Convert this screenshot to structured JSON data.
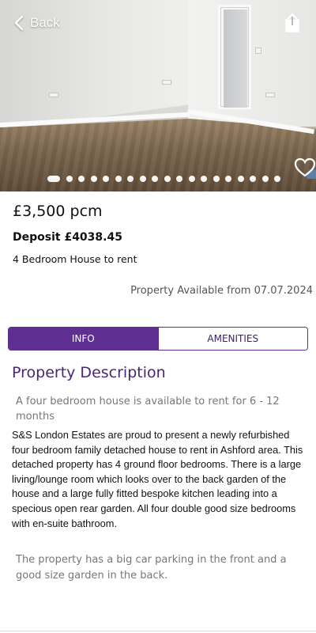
{
  "header": {
    "back_label": "Back",
    "back_icon": "chevron-left-icon",
    "share_icon": "share-icon",
    "favorite_icon": "heart-icon"
  },
  "gallery": {
    "image_count": 19,
    "active_index": 0
  },
  "listing": {
    "price": "£3,500 pcm",
    "deposit": "Deposit £4038.45",
    "type": "4 Bedroom House to rent",
    "available": "Property Available from 07.07.2024"
  },
  "tabs": [
    {
      "label": "INFO",
      "active": true
    },
    {
      "label": "AMENITIES",
      "active": false
    }
  ],
  "description": {
    "title": "Property Description",
    "lead": "A four bedroom house is available to rent for 6 - 12 months",
    "body": "S&S London Estates are proud to present a newly refurbished four bedroom family detached house to rent in Ashford area. This detached property has 4 ground floor bedrooms. There is a large living/lounge room which looks over to the back garden of the house and a large fully fitted bespoke kitchen leading into a specious open rear garden. All four double good size bedrooms with en-suite bathroom.",
    "extra": "The property has a big car parking in the front and a good size garden in the back."
  },
  "colors": {
    "accent": "#5e2e91",
    "title": "#4a2577",
    "muted": "#777777"
  }
}
